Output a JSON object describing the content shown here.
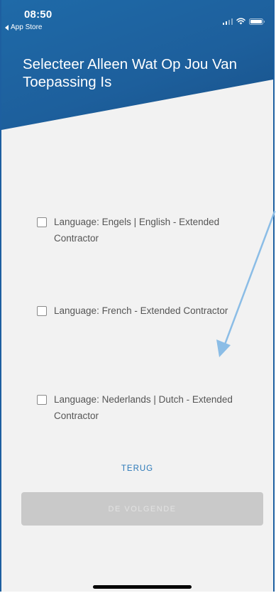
{
  "status_bar": {
    "time": "08:50",
    "back_label": "App Store"
  },
  "header": {
    "title": "Selecteer Alleen Wat Op Jou Van Toepassing Is"
  },
  "options": [
    {
      "label": "Language: Engels | English - Extended Contractor",
      "checked": false
    },
    {
      "label": "Language: French - Extended Contractor",
      "checked": false
    },
    {
      "label": "Language: Nederlands | Dutch - Extended Contractor",
      "checked": false
    }
  ],
  "actions": {
    "back_label": "TERUG",
    "next_label": "DE VOLGENDE",
    "next_enabled": false
  },
  "colors": {
    "header": "#1d5f9c",
    "background": "#f2f2f2",
    "link": "#2a78b8",
    "button_disabled": "#c9c9c9",
    "annotation_arrow": "#8bbde6"
  },
  "icons": {
    "signal": "cellular-signal-icon",
    "wifi": "wifi-icon",
    "battery": "battery-icon",
    "back": "back-arrow-icon"
  }
}
